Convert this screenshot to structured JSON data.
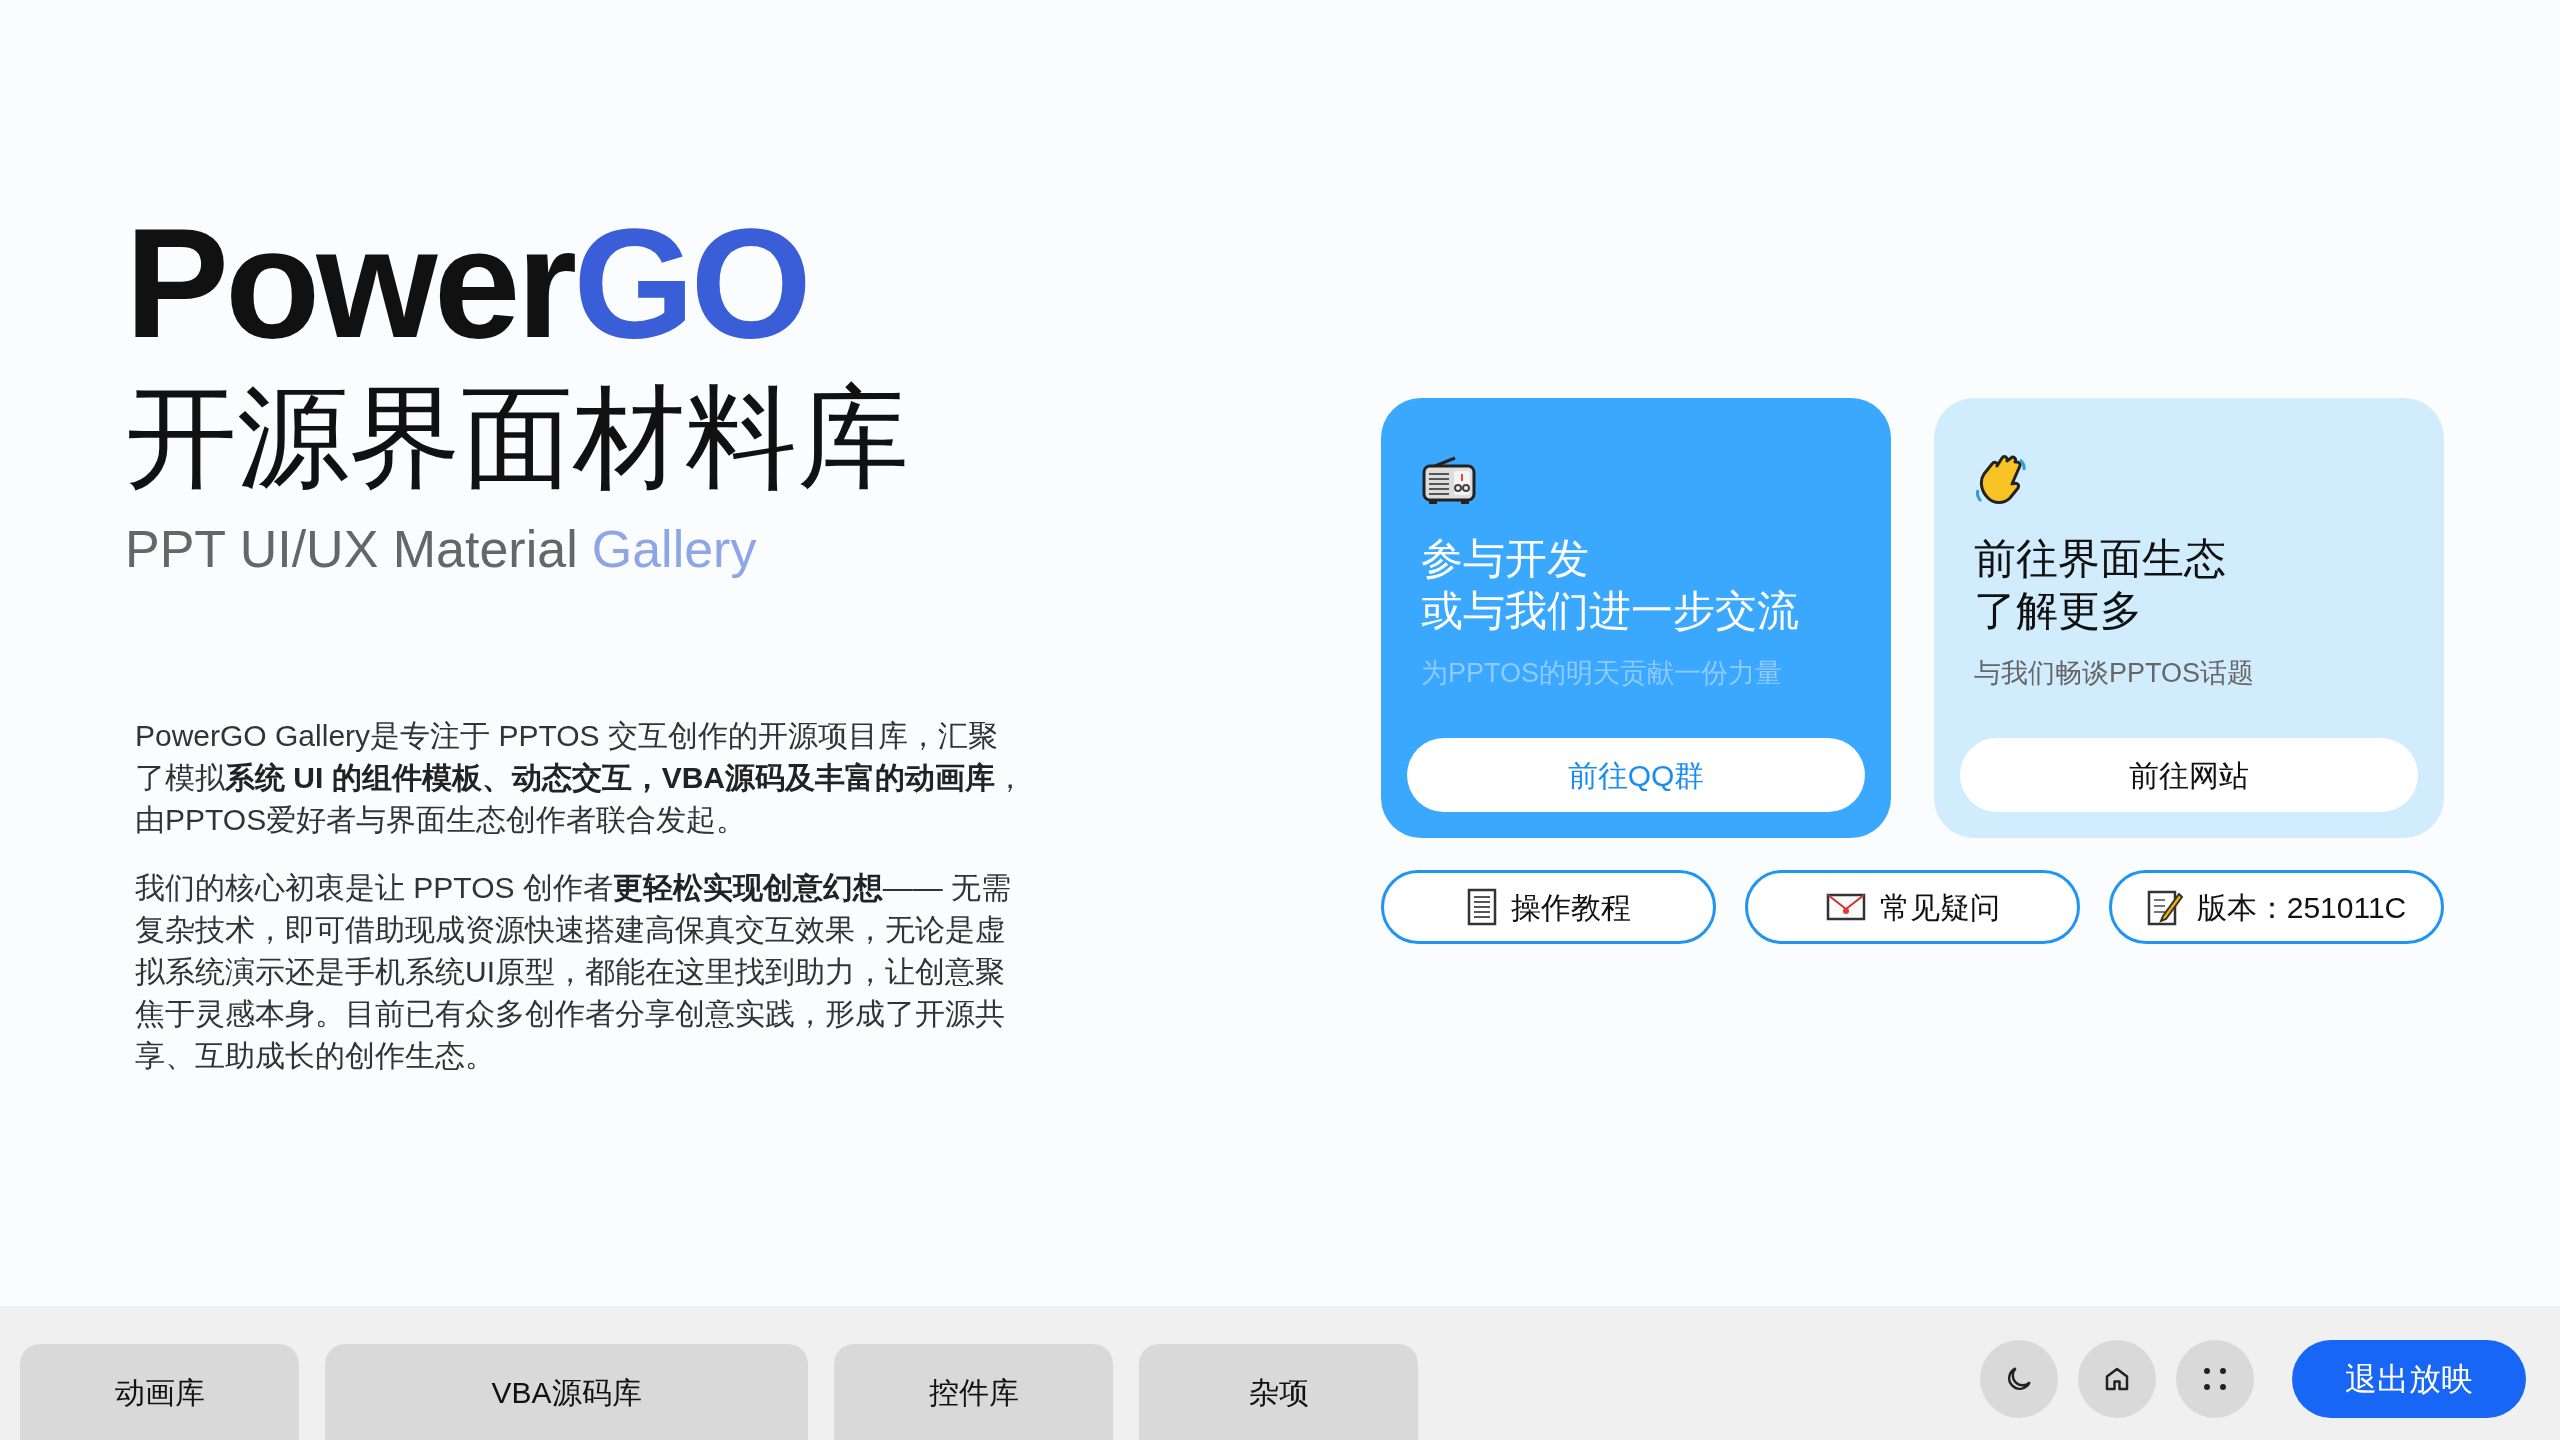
{
  "hero": {
    "title_main": "Power",
    "title_accent": "GO",
    "title_cn": "开源界面材料库",
    "subtitle_main": "PPT UI/UX Material",
    "subtitle_accent": "Gallery"
  },
  "paragraphs": [
    "PowerGO Gallery是专注于 PPTOS 交互创作的开源项目库，汇聚了模拟**系统 UI 的组件模板、动态交互，VBA源码及丰富的动画库**，由PPTOS爱好者与界面生态创作者联合发起。",
    "我们的核心初衷是让 PPTOS 创作者**更轻松实现创意幻想**—— 无需复杂技术，即可借助现成资源快速搭建高保真交互效果，无论是虚拟系统演示还是手机系统UI原型，都能在这里找到助力，让创意聚焦于灵感本身。目前已有众多创作者分享创意实践，形成了开源共享、互助成长的创作生态。"
  ],
  "cards": [
    {
      "kind": "primary",
      "title_lines": [
        "参与开发",
        "或与我们进一步交流"
      ],
      "caption": "为PPTOS的明天贡献一份力量",
      "button": "前往QQ群"
    },
    {
      "kind": "secondary",
      "title_lines": [
        "前往界面生态",
        "了解更多"
      ],
      "caption": "与我们畅谈PPTOS话题",
      "button": "前往网站"
    }
  ],
  "links": [
    {
      "label": "操作教程"
    },
    {
      "label": "常见疑问"
    },
    {
      "label": "版本：251011C"
    }
  ],
  "bottom_bar": {
    "tabs": [
      "动画库",
      "VBA源码库",
      "控件库",
      "杂项"
    ],
    "exit_button": "退出放映"
  }
}
